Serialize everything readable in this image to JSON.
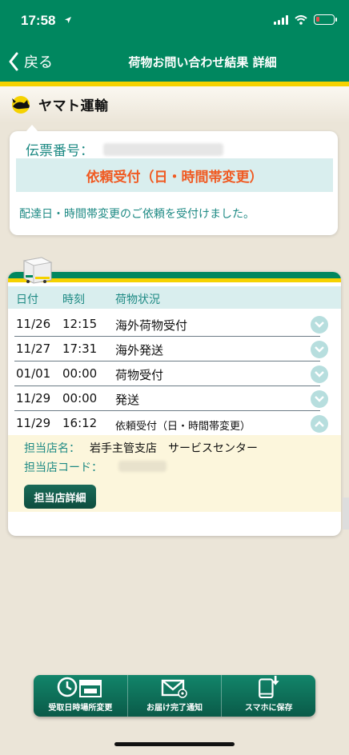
{
  "status_bar": {
    "time": "17:58"
  },
  "nav": {
    "back_label": "戻る",
    "title": "荷物お問い合わせ結果 詳細"
  },
  "brand": {
    "name": "ヤマト運輸"
  },
  "summary": {
    "slip_label": "伝票番号：",
    "status": "依頼受付（日・時間帯変更）",
    "message": "配達日・時間帯変更のご依頼を受付けました。"
  },
  "history": {
    "headers": {
      "date": "日付",
      "time": "時刻",
      "status": "荷物状況"
    },
    "rows": [
      {
        "date": "11/26",
        "time": "12:15",
        "status": "海外荷物受付"
      },
      {
        "date": "11/27",
        "time": "17:31",
        "status": "海外発送"
      },
      {
        "date": "01/01",
        "time": "00:00",
        "status": "荷物受付"
      },
      {
        "date": "11/29",
        "time": "00:00",
        "status": "発送"
      },
      {
        "date": "11/29",
        "time": "16:12",
        "status": "依頼受付（日・時間帯変更）"
      }
    ],
    "detail": {
      "store_label": "担当店名：",
      "store_value": "岩手主管支店　サービスセンター",
      "code_label": "担当店コード：",
      "store_button": "担当店詳細"
    }
  },
  "bottom_bar": {
    "change_label": "受取日時場所変更",
    "notify_label": "お届け完了通知",
    "save_label": "スマホに保存"
  },
  "colors": {
    "brand_green": "#00875f",
    "brand_yellow": "#f5d200",
    "accent_orange": "#f05a22",
    "teal_text": "#1e8a84"
  }
}
